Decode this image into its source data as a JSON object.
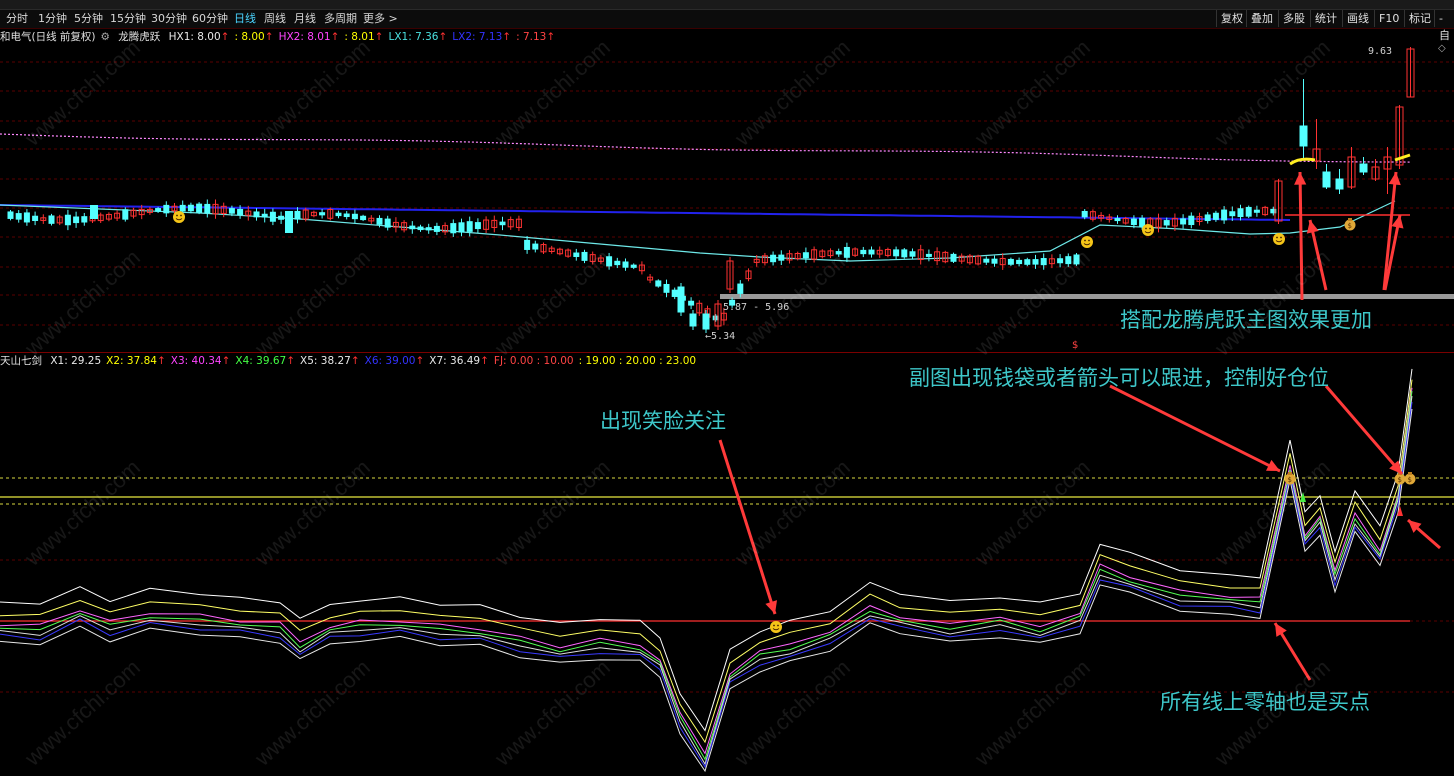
{
  "toolbar": {
    "periods": [
      "分时",
      "1分钟",
      "5分钟",
      "15分钟",
      "30分钟",
      "60分钟",
      "日线",
      "周线",
      "月线",
      "多周期",
      "更多 >"
    ],
    "active_period": "日线",
    "right_buttons": [
      "复权",
      "叠加",
      "多股",
      "统计",
      "画线",
      "F10",
      "标记",
      "-自"
    ]
  },
  "main_chart": {
    "stock_title": "和电气(日线 前复权)",
    "indicator_name": "龙腾虎跃",
    "legend": [
      {
        "label": "HX1: 8.00",
        "arrow": "↑",
        "color": "#e8e8e8"
      },
      {
        "label": ": 8.00",
        "arrow": "↑",
        "color": "#ffff00"
      },
      {
        "label": "HX2: 8.01",
        "arrow": "↑",
        "color": "#ff44ff"
      },
      {
        "label": ": 8.01",
        "arrow": "↑",
        "color": "#ffff00"
      },
      {
        "label": "LX1: 7.36",
        "arrow": "↑",
        "color": "#4ae0e0"
      },
      {
        "label": "LX2: 7.13",
        "arrow": "↑",
        "color": "#3333ff"
      },
      {
        "label": ": 7.13",
        "arrow": "↑",
        "color": "#ff4444"
      }
    ],
    "high_label": "9.63",
    "range_label": "5.87 - 5.96",
    "low_label": "5.34",
    "dollar_marker": "$"
  },
  "sub_chart": {
    "indicator_name": "天山七剑",
    "legend": [
      {
        "label": "X1: 29.25",
        "arrow": "",
        "color": "#e8e8e8"
      },
      {
        "label": "X2: 37.84",
        "arrow": "↑",
        "color": "#ffff00"
      },
      {
        "label": "X3: 40.34",
        "arrow": "↑",
        "color": "#ff44ff"
      },
      {
        "label": "X4: 39.67",
        "arrow": "↑",
        "color": "#44ff44"
      },
      {
        "label": "X5: 38.27",
        "arrow": "↑",
        "color": "#e8e8e8"
      },
      {
        "label": "X6: 39.00",
        "arrow": "↑",
        "color": "#3333ff"
      },
      {
        "label": "X7: 36.49",
        "arrow": "↑",
        "color": "#e8e8e8"
      },
      {
        "label": "FJ: 0.00 : 10.00",
        "arrow": "",
        "color": "#ff4444"
      },
      {
        "label": ": 19.00 : 20.00 : 23.00",
        "arrow": "",
        "color": "#ffff00"
      }
    ]
  },
  "annotations": {
    "main_combo": "搭配龙腾虎跃主图效果更加",
    "sub_follow": "副图出现钱袋或者箭头可以跟进，控制好仓位",
    "smile_watch": "出现笑脸关注",
    "zero_axis": "所有线上零轴也是买点"
  },
  "watermark": "www.cfchi.com",
  "colors": {
    "up": "#ff3232",
    "down": "#54ffff",
    "annotation": "#3ec7c9",
    "arrow": "#ff3a3a",
    "grid": "#5a0000"
  }
}
